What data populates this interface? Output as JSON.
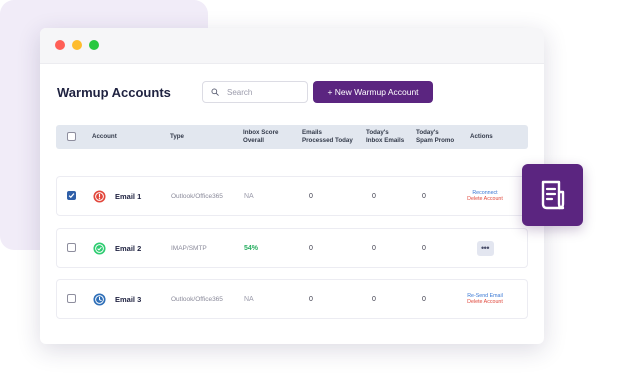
{
  "page": {
    "title": "Warmup Accounts",
    "search_placeholder": "Search",
    "new_button_label": "+ New Warmup Account"
  },
  "columns": {
    "account": "Account",
    "type": "Type",
    "inbox_score_line1": "Inbox Score",
    "inbox_score_line2": "Overall",
    "emails_processed_line1": "Emails",
    "emails_processed_line2": "Processed Today",
    "inbox_emails_line1": "Today's",
    "inbox_emails_line2": "Inbox Emails",
    "spam_promo_line1": "Today's",
    "spam_promo_line2": "Spam Promo",
    "actions": "Actions"
  },
  "rows": [
    {
      "name": "Email 1",
      "type": "Outlook/Office365",
      "score": "NA",
      "processed": "0",
      "inbox": "0",
      "spam": "0",
      "checked": true,
      "status_icon": "error-icon",
      "status_color": "#e2483d",
      "action_primary": "Reconnect",
      "action_secondary": "Delete Account"
    },
    {
      "name": "Email 2",
      "type": "IMAP/SMTP",
      "score": "54%",
      "processed": "0",
      "inbox": "0",
      "spam": "0",
      "checked": false,
      "status_icon": "check-circle-icon",
      "status_color": "#2ecc71",
      "action_primary": "more-options-icon"
    },
    {
      "name": "Email 3",
      "type": "Outlook/Office365",
      "score": "NA",
      "processed": "0",
      "inbox": "0",
      "spam": "0",
      "checked": false,
      "status_icon": "clock-icon",
      "status_color": "#2f6fb8",
      "action_primary": "Re-Send Email",
      "action_secondary": "Delete Account"
    }
  ],
  "colors": {
    "accent": "#5b2580",
    "link_blue": "#3978d4",
    "link_red": "#e0473b",
    "header_bg": "#e2e7ef",
    "score_good": "#27ae60"
  },
  "decorations": {
    "badge_icon": "document-icon"
  }
}
